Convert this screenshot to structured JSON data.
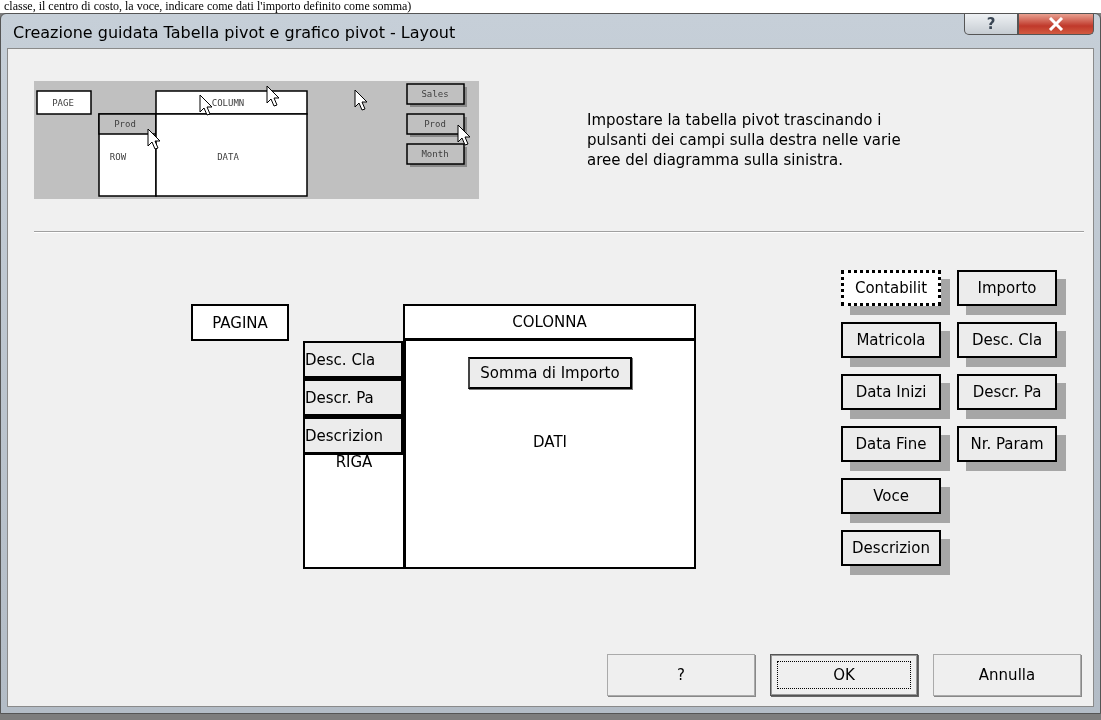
{
  "text_above": "classe, il centro di costo, la voce, indicare come dati l'importo definito come somma)",
  "window": {
    "title": "Creazione guidata Tabella pivot e grafico pivot - Layout",
    "help_glyph": "?"
  },
  "preview": {
    "page": "PAGE",
    "column": "COLUMN",
    "row_field": "Prod",
    "row": "ROW",
    "data": "DATA",
    "fields": [
      "Sales",
      "Prod",
      "Month"
    ]
  },
  "instructions": "Impostare la tabella pivot trascinando i pulsanti dei campi sulla destra nelle varie aree del diagramma sulla sinistra.",
  "layout": {
    "page_label": "PAGINA",
    "column_label": "COLONNA",
    "row_label": "RIGA",
    "data_label": "DATI",
    "row_fields": [
      "Desc. Cla",
      "Descr. Pa",
      "Descrizion"
    ],
    "data_fields": [
      "Somma di Importo"
    ]
  },
  "fields": [
    {
      "label": "Contabilit",
      "focused": true
    },
    {
      "label": "Matricola",
      "focused": false
    },
    {
      "label": "Data Inizi",
      "focused": false
    },
    {
      "label": "Data Fine",
      "focused": false
    },
    {
      "label": "Voce",
      "focused": false
    },
    {
      "label": "Descrizion",
      "focused": false
    },
    {
      "label": "Importo",
      "focused": false
    },
    {
      "label": "Desc. Cla",
      "focused": false
    },
    {
      "label": "Descr. Pa",
      "focused": false
    },
    {
      "label": "Nr. Param",
      "focused": false
    }
  ],
  "buttons": [
    {
      "label": "?",
      "focused": false
    },
    {
      "label": "OK",
      "focused": true
    },
    {
      "label": "Annulla",
      "focused": false
    }
  ]
}
